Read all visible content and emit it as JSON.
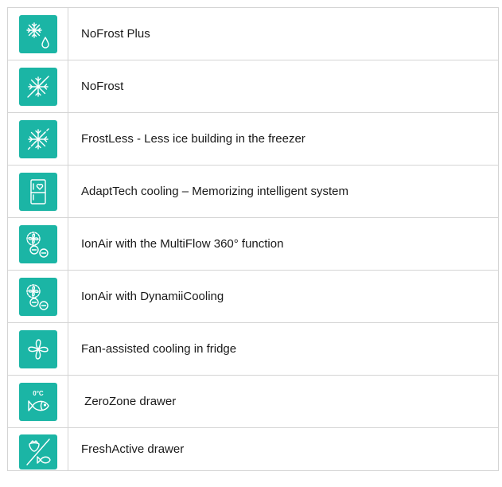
{
  "features": [
    {
      "icon": "snowflake-drop-icon",
      "label": "NoFrost Plus"
    },
    {
      "icon": "snowflake-slash-icon",
      "label": "NoFrost"
    },
    {
      "icon": "snowflake-dashed-slash-icon",
      "label": "FrostLess - Less ice building in the freezer"
    },
    {
      "icon": "fridge-heart-icon",
      "label": "AdaptTech cooling – Memorizing intelligent system"
    },
    {
      "icon": "fan-ions-icon",
      "label": "IonAir with the MultiFlow 360° function"
    },
    {
      "icon": "fan-ions-icon",
      "label": "IonAir with DynamiiCooling"
    },
    {
      "icon": "fan-icon",
      "label": "Fan-assisted cooling in fridge"
    },
    {
      "icon": "fish-zero-degree-icon",
      "label": " ZeroZone drawer",
      "icon_text": "0°C"
    },
    {
      "icon": "strawberry-fish-icon",
      "label": "FreshActive drawer"
    }
  ],
  "colors": {
    "icon_bg": "#1bb5a5",
    "border": "#d4d4d4",
    "text": "#1a1a1a"
  }
}
